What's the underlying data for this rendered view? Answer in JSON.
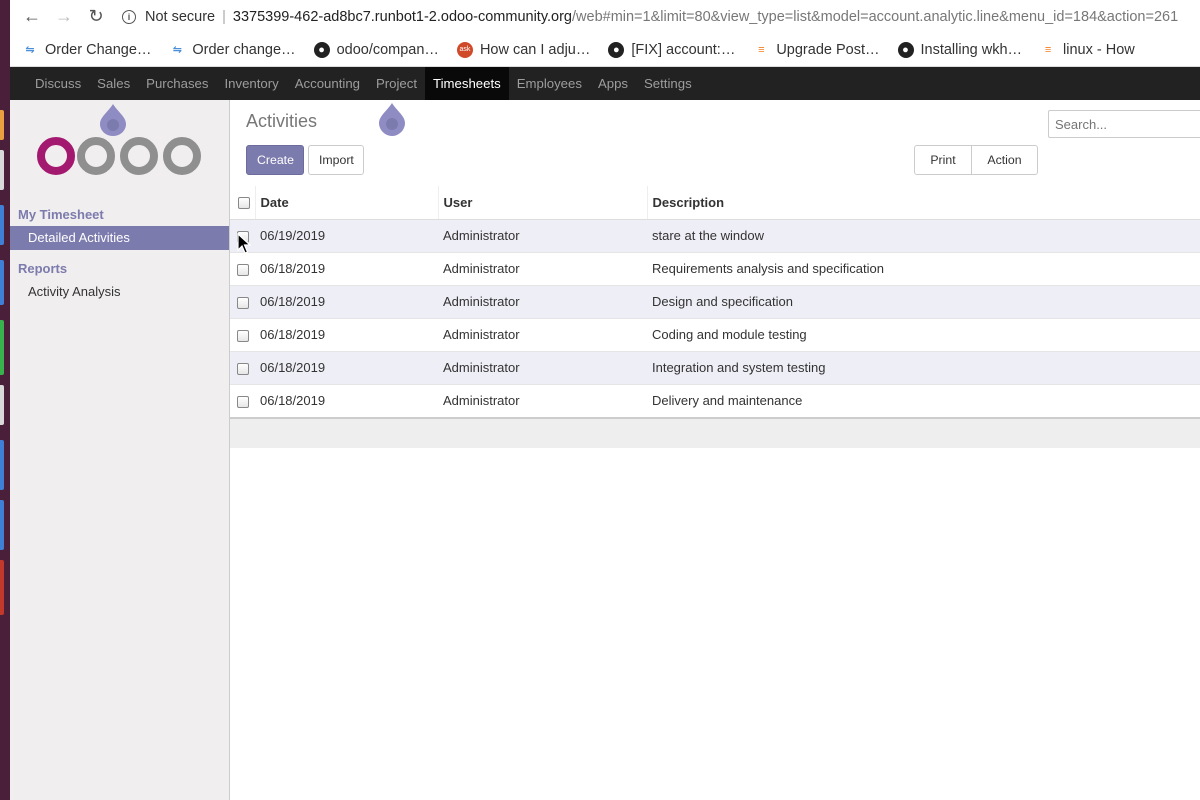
{
  "browser": {
    "security_label": "Not secure",
    "url_host": "3375399-462-ad8bc7.runbot1-2.odoo-community.org",
    "url_path": "/web#min=1&limit=80&view_type=list&model=account.analytic.line&menu_id=184&action=261",
    "bookmarks": [
      {
        "label": "Order Change…",
        "icon": "sap-icon"
      },
      {
        "label": "Order change…",
        "icon": "sap-icon"
      },
      {
        "label": "odoo/compan…",
        "icon": "github-icon"
      },
      {
        "label": "How can I adju…",
        "icon": "askbot-icon"
      },
      {
        "label": "[FIX] account:…",
        "icon": "github-icon"
      },
      {
        "label": "Upgrade Post…",
        "icon": "stackoverflow-icon"
      },
      {
        "label": "Installing wkh…",
        "icon": "github-icon"
      },
      {
        "label": "linux - How",
        "icon": "stackoverflow-icon"
      }
    ]
  },
  "mainnav": {
    "items": [
      "Discuss",
      "Sales",
      "Purchases",
      "Inventory",
      "Accounting",
      "Project",
      "Timesheets",
      "Employees",
      "Apps",
      "Settings"
    ],
    "active": "Timesheets"
  },
  "sidebar": {
    "section1": "My Timesheet",
    "item_detailed": "Detailed Activities",
    "section2": "Reports",
    "item_analysis": "Activity Analysis"
  },
  "control": {
    "breadcrumb": "Activities",
    "create": "Create",
    "import": "Import",
    "print": "Print",
    "action": "Action",
    "search_placeholder": "Search..."
  },
  "list": {
    "columns": [
      "Date",
      "User",
      "Description"
    ],
    "rows": [
      {
        "date": "06/19/2019",
        "user": "Administrator",
        "description": "stare at the window",
        "checked": true
      },
      {
        "date": "06/18/2019",
        "user": "Administrator",
        "description": "Requirements analysis and specification",
        "checked": false
      },
      {
        "date": "06/18/2019",
        "user": "Administrator",
        "description": "Design and specification",
        "checked": false
      },
      {
        "date": "06/18/2019",
        "user": "Administrator",
        "description": "Coding and module testing",
        "checked": false
      },
      {
        "date": "06/18/2019",
        "user": "Administrator",
        "description": "Integration and system testing",
        "checked": false
      },
      {
        "date": "06/18/2019",
        "user": "Administrator",
        "description": "Delivery and maintenance",
        "checked": false
      }
    ]
  },
  "colors": {
    "brand": "#7c7bad",
    "navbar": "#222222",
    "odd_row": "#eeeef6"
  }
}
